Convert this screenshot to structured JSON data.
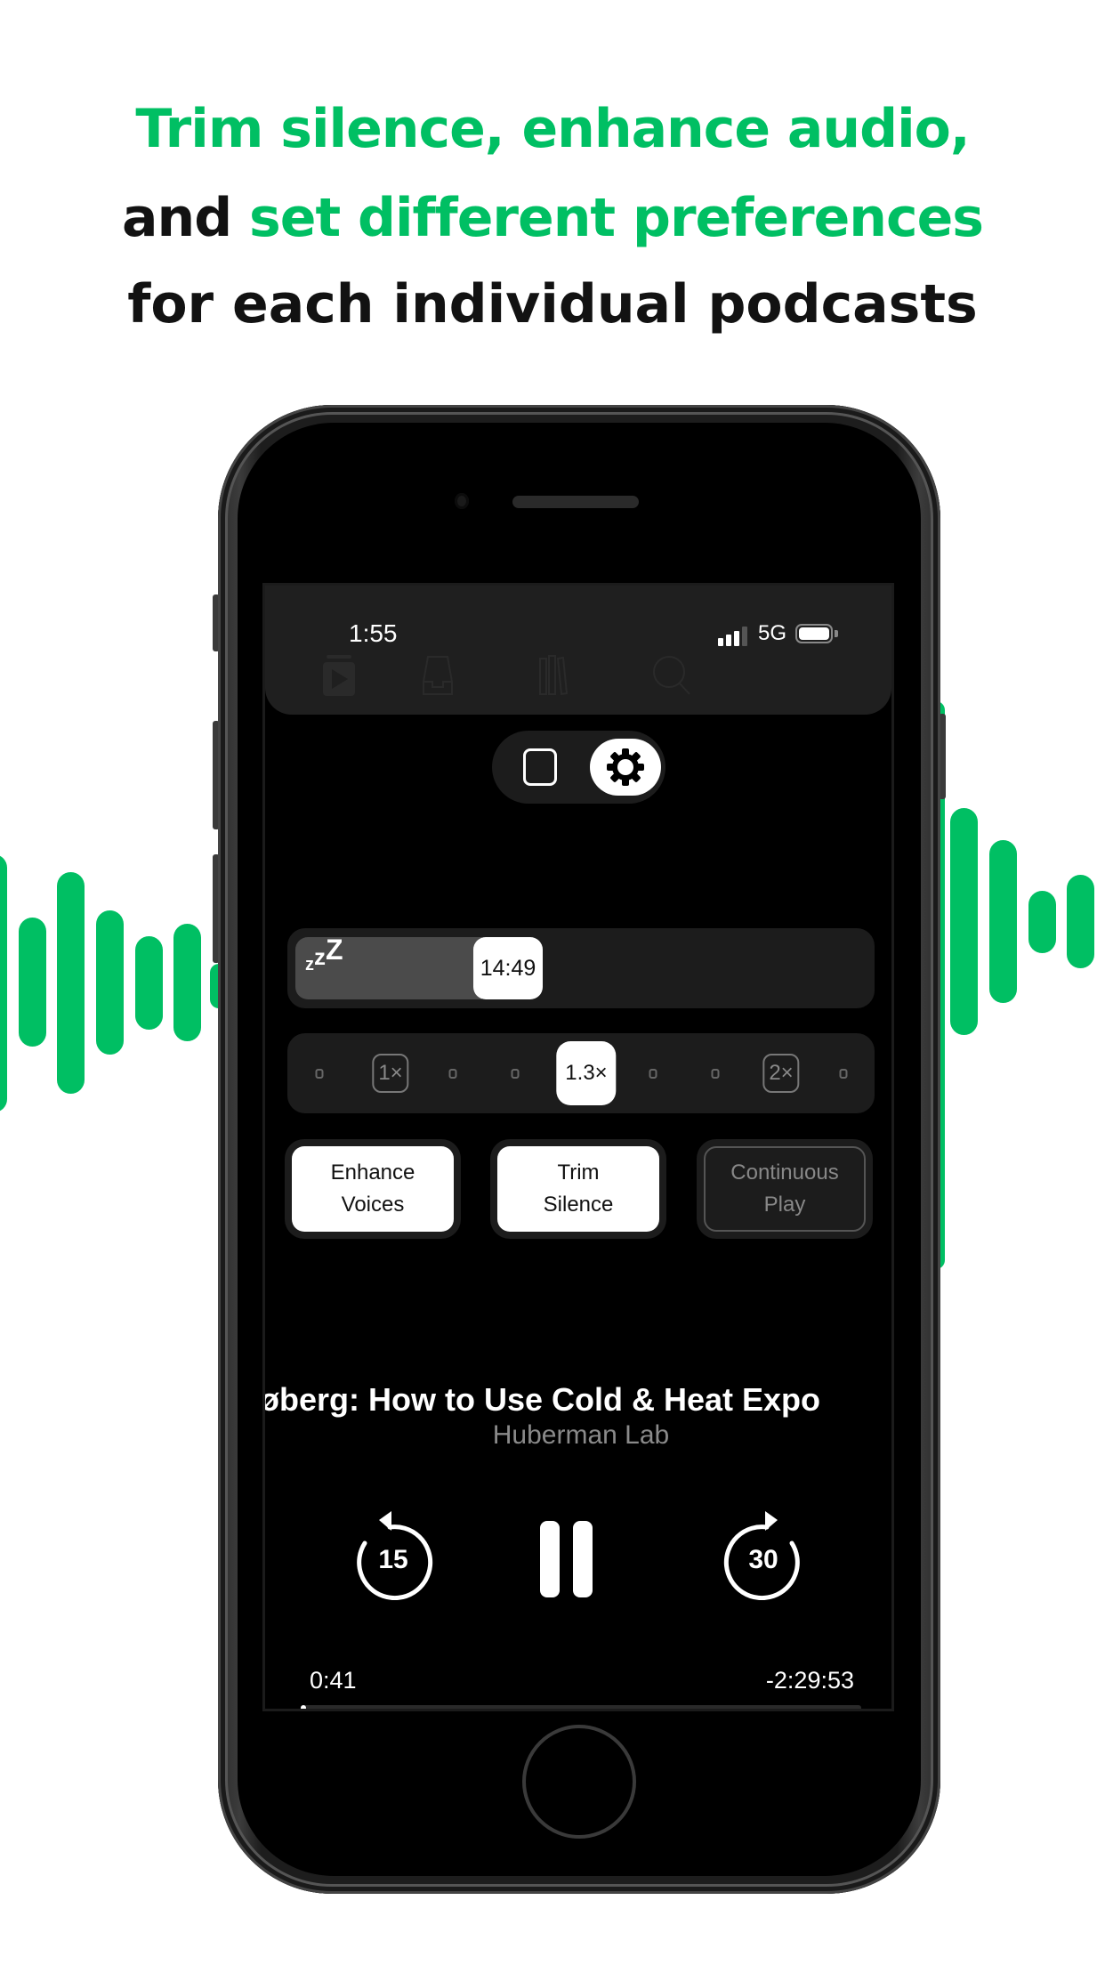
{
  "headline": {
    "line1": "Trim silence, enhance audio,",
    "line2_prefix": "and ",
    "line2_highlight": "set different preferences",
    "line3": "for each individual podcasts"
  },
  "colors": {
    "brand_green": "#00bf63",
    "text_dark": "#121212",
    "screen_bg": "#000000",
    "panel_bg": "#1c1c1c"
  },
  "status_bar": {
    "time": "1:55",
    "network": "5G",
    "signal_bars_active": 3,
    "signal_bars_total": 4,
    "battery_level": 1.0
  },
  "tab_bar": {
    "items": [
      {
        "icon": "queue-play-icon"
      },
      {
        "icon": "inbox-icon"
      },
      {
        "icon": "library-icon"
      },
      {
        "icon": "search-icon"
      }
    ]
  },
  "mode_toggle": {
    "options": [
      {
        "icon": "card-icon",
        "selected": false
      },
      {
        "icon": "gear-icon",
        "selected": true
      }
    ]
  },
  "sleep_timer": {
    "icon": "sleep-zzz-icon",
    "label": "zzZ",
    "value": "14:49",
    "fill_fraction": 0.35
  },
  "speed": {
    "selected": "1.3×",
    "marks": [
      "1×",
      "2×"
    ],
    "steps": [
      "",
      "1×",
      "",
      "",
      "1.3×",
      "",
      "",
      "2×",
      ""
    ]
  },
  "options": [
    {
      "line1": "Enhance",
      "line2": "Voices",
      "enabled": true
    },
    {
      "line1": "Trim",
      "line2": "Silence",
      "enabled": true
    },
    {
      "line1": "Continuous",
      "line2": "Play",
      "enabled": false
    }
  ],
  "episode": {
    "title": "øberg: How to Use Cold & Heat Expo",
    "show": "Huberman Lab"
  },
  "controls": {
    "skip_back": "15",
    "skip_forward": "30",
    "state": "playing"
  },
  "playback": {
    "elapsed": "0:41",
    "remaining": "-2:29:53",
    "progress_fraction": 0.005
  }
}
